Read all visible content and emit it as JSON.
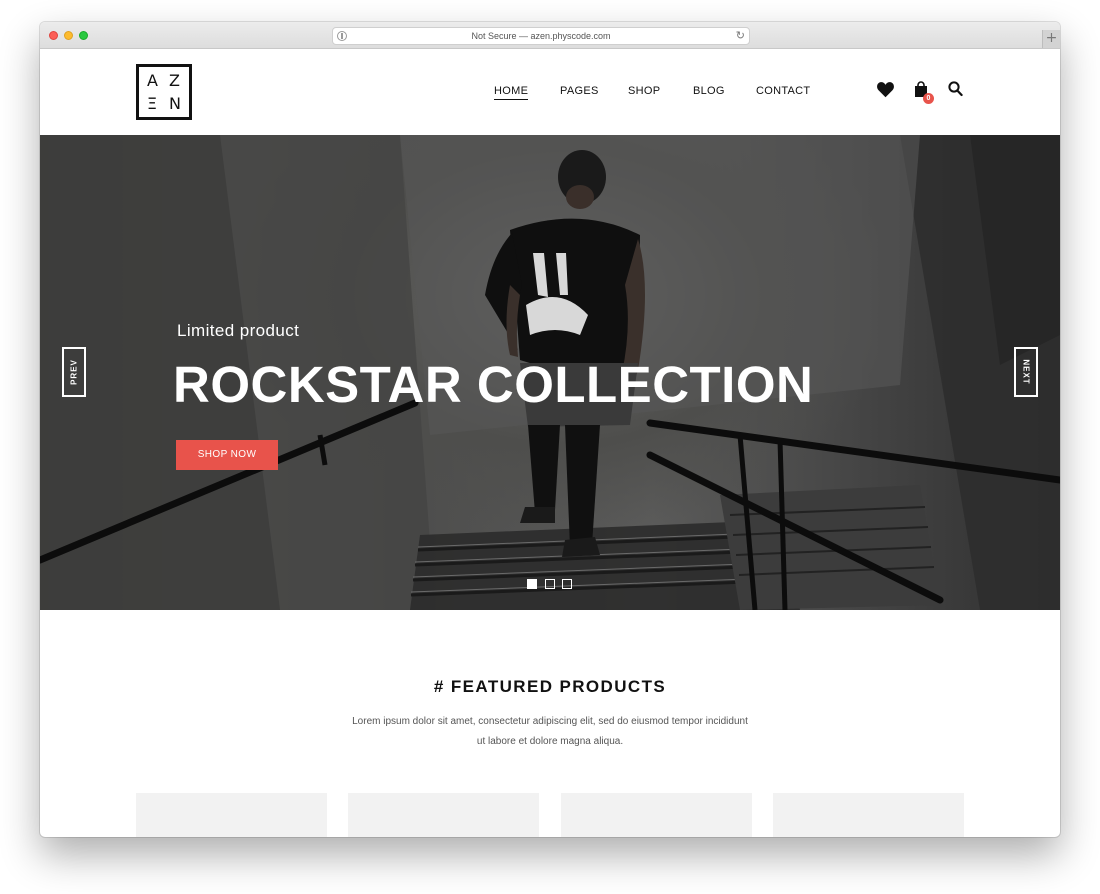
{
  "browser": {
    "url_text": "Not Secure — azen.physcode.com",
    "new_tab_label": "+",
    "reload_glyph": "↻"
  },
  "logo": {
    "letters": [
      "A",
      "Z",
      "Ξ",
      "N"
    ]
  },
  "nav": {
    "items": [
      {
        "label": "HOME",
        "active": true
      },
      {
        "label": "PAGES",
        "active": false
      },
      {
        "label": "SHOP",
        "active": false
      },
      {
        "label": "BLOG",
        "active": false
      },
      {
        "label": "CONTACT",
        "active": false
      }
    ]
  },
  "header_icons": {
    "wishlist": "heart-icon",
    "cart": "shopping-bag-icon",
    "cart_count": "0",
    "search": "search-icon"
  },
  "hero": {
    "subtitle": "Limited product",
    "title": "ROCKSTAR COLLECTION",
    "cta_label": "SHOP NOW",
    "prev_label": "PREV",
    "next_label": "NEXT",
    "active_slide": 1,
    "slide_count": 3
  },
  "featured": {
    "title": "# FEATURED PRODUCTS",
    "description": "Lorem ipsum dolor sit amet, consectetur adipiscing elit, sed do eiusmod tempor incididunt ut labore et dolore magna aliqua.",
    "card_count": 4
  },
  "colors": {
    "accent": "#e8534b",
    "text": "#111111",
    "card_bg": "#f2f2f2"
  }
}
